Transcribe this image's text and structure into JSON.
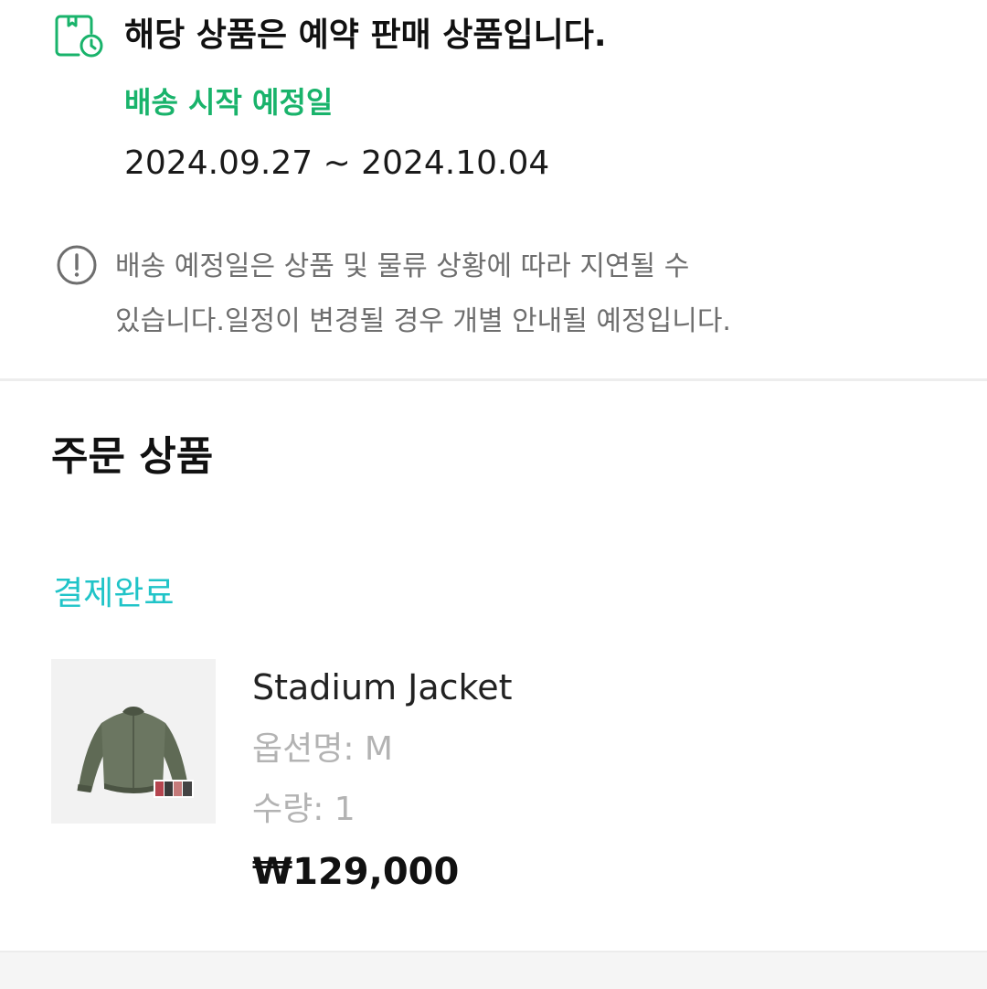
{
  "preorder": {
    "title": "해당 상품은 예약 판매 상품입니다.",
    "shipping_label": "배송 시작 예정일",
    "shipping_dates": "2024.09.27 ~ 2024.10.04",
    "notice_line1": "배송 예정일은 상품 및 물류 상황에 따라 지연될 수",
    "notice_line2": "있습니다.일정이 변경될 경우 개별 안내될 예정입니다.",
    "icons": [
      "calendar-clock-icon",
      "info-circle-icon"
    ],
    "accent_color": "#19b36b"
  },
  "order": {
    "section_title": "주문 상품",
    "status": "결제완료",
    "status_color": "#20c4c8",
    "item": {
      "name": "Stadium Jacket",
      "option": "옵션명: M",
      "quantity": "수량: 1",
      "price": "₩129,000"
    }
  }
}
